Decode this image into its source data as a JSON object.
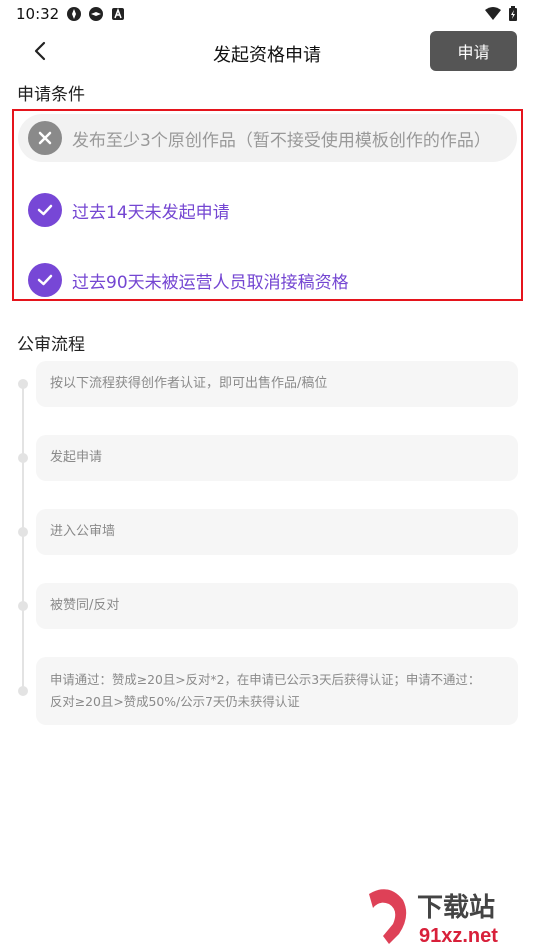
{
  "status_bar": {
    "time": "10:32"
  },
  "nav": {
    "title": "发起资格申请",
    "apply_button": "申请"
  },
  "conditions": {
    "title": "申请条件",
    "items": [
      {
        "text": "发布至少3个原创作品（暂不接受使用模板创作的作品）",
        "status": "failed",
        "icon": "close-icon"
      },
      {
        "text": "过去14天未发起申请",
        "status": "passed",
        "icon": "check-icon"
      },
      {
        "text": "过去90天未被运营人员取消接稿资格",
        "status": "passed",
        "icon": "check-icon"
      }
    ]
  },
  "review": {
    "title": "公审流程",
    "steps": [
      {
        "text": "按以下流程获得创作者认证，即可出售作品/稿位"
      },
      {
        "text": "发起申请"
      },
      {
        "text": "进入公审墙"
      },
      {
        "text": "被赞同/反对"
      },
      {
        "line1": "申请通过：赞成≥20且>反对*2，在申请已公示3天后获得认证；申请不通过：",
        "line2": "反对≥20且>赞成50%/公示7天仍未获得认证"
      }
    ]
  },
  "watermark": {
    "brand": "下载站",
    "domain": "91xz.net"
  },
  "colors": {
    "accent": "#7446d2",
    "highlight_border": "#e5141c",
    "button_bg": "#555555"
  }
}
